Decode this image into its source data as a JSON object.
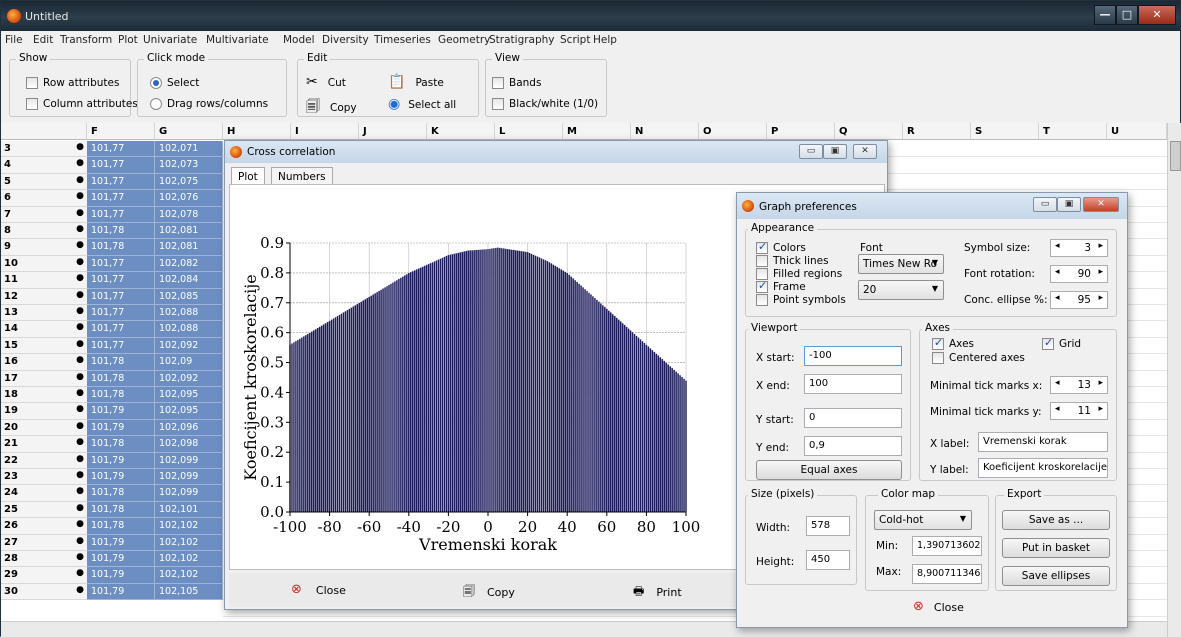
{
  "main_window": {
    "title": "Untitled",
    "controls": {
      "minimize": "—",
      "maximize": "□",
      "close": "✕"
    }
  },
  "menu": [
    "File",
    "Edit",
    "Transform",
    "Plot",
    "Univariate",
    "Multivariate",
    "Model",
    "Diversity",
    "Timeseries",
    "Geometry",
    "Stratigraphy",
    "Script",
    "Help"
  ],
  "toolbar": {
    "show": {
      "label": "Show",
      "row_attributes": "Row attributes",
      "column_attributes": "Column attributes"
    },
    "click_mode": {
      "label": "Click mode",
      "select": "Select",
      "drag": "Drag rows/columns"
    },
    "edit": {
      "label": "Edit",
      "cut": "Cut",
      "paste": "Paste",
      "copy": "Copy",
      "select_all": "Select all"
    },
    "view": {
      "label": "View",
      "bands": "Bands",
      "black_white": "Black/white (1/0)"
    }
  },
  "grid": {
    "columns": [
      "F",
      "G",
      "H",
      "I",
      "J",
      "K",
      "L",
      "M",
      "N",
      "O",
      "P",
      "Q",
      "R",
      "S",
      "T",
      "U"
    ],
    "rows": [
      {
        "id": "3",
        "f": "101,77",
        "g": "102,071"
      },
      {
        "id": "4",
        "f": "101,77",
        "g": "102,073"
      },
      {
        "id": "5",
        "f": "101,77",
        "g": "102,075"
      },
      {
        "id": "6",
        "f": "101,77",
        "g": "102,076"
      },
      {
        "id": "7",
        "f": "101,77",
        "g": "102,078"
      },
      {
        "id": "8",
        "f": "101,78",
        "g": "102,081"
      },
      {
        "id": "9",
        "f": "101,78",
        "g": "102,081"
      },
      {
        "id": "10",
        "f": "101,77",
        "g": "102,082"
      },
      {
        "id": "11",
        "f": "101,77",
        "g": "102,084"
      },
      {
        "id": "12",
        "f": "101,77",
        "g": "102,085"
      },
      {
        "id": "13",
        "f": "101,77",
        "g": "102,088"
      },
      {
        "id": "14",
        "f": "101,77",
        "g": "102,088"
      },
      {
        "id": "15",
        "f": "101,77",
        "g": "102,092"
      },
      {
        "id": "16",
        "f": "101,78",
        "g": "102,09"
      },
      {
        "id": "17",
        "f": "101,78",
        "g": "102,092"
      },
      {
        "id": "18",
        "f": "101,78",
        "g": "102,095"
      },
      {
        "id": "19",
        "f": "101,79",
        "g": "102,095"
      },
      {
        "id": "20",
        "f": "101,79",
        "g": "102,096"
      },
      {
        "id": "21",
        "f": "101,78",
        "g": "102,098"
      },
      {
        "id": "22",
        "f": "101,79",
        "g": "102,099"
      },
      {
        "id": "23",
        "f": "101,79",
        "g": "102,099"
      },
      {
        "id": "24",
        "f": "101,78",
        "g": "102,099"
      },
      {
        "id": "25",
        "f": "101,78",
        "g": "102,101"
      },
      {
        "id": "26",
        "f": "101,78",
        "g": "102,102"
      },
      {
        "id": "27",
        "f": "101,79",
        "g": "102,102"
      },
      {
        "id": "28",
        "f": "101,79",
        "g": "102,102"
      },
      {
        "id": "29",
        "f": "101,79",
        "g": "102,102"
      },
      {
        "id": "30",
        "f": "101,79",
        "g": "102,105"
      }
    ]
  },
  "cross_correlation": {
    "title": "Cross correlation",
    "tabs": [
      "Plot",
      "Numbers"
    ],
    "close": "Close",
    "copy": "Copy",
    "print": "Print"
  },
  "chart_data": {
    "type": "bar",
    "xlabel": "Vremenski korak",
    "ylabel": "Koeficijent kroskorelacije",
    "xlim": [
      -100,
      100
    ],
    "ylim": [
      0,
      0.9
    ],
    "xticks": [
      "-100",
      "-80",
      "-60",
      "-40",
      "-20",
      "0",
      "20",
      "40",
      "60",
      "80",
      "100"
    ],
    "yticks": [
      "0.0",
      "0.1",
      "0.2",
      "0.3",
      "0.4",
      "0.5",
      "0.6",
      "0.7",
      "0.8",
      "0.9"
    ],
    "x": [
      -100,
      -90,
      -80,
      -70,
      -60,
      -50,
      -40,
      -30,
      -20,
      -10,
      0,
      5,
      10,
      20,
      30,
      40,
      50,
      60,
      70,
      80,
      90,
      100
    ],
    "y": [
      0.56,
      0.6,
      0.64,
      0.68,
      0.72,
      0.76,
      0.8,
      0.83,
      0.86,
      0.875,
      0.88,
      0.885,
      0.88,
      0.87,
      0.84,
      0.8,
      0.74,
      0.68,
      0.62,
      0.56,
      0.5,
      0.44
    ],
    "grid": true,
    "bar_color": "#1c1c5c"
  },
  "graph_preferences": {
    "title": "Graph preferences",
    "appearance": {
      "label": "Appearance",
      "colors": "Colors",
      "thick_lines": "Thick lines",
      "filled_regions": "Filled regions",
      "frame": "Frame",
      "point_symbols": "Point symbols",
      "font_label": "Font",
      "font_value": "Times New Ro",
      "font_size": "20",
      "symbol_size_label": "Symbol size:",
      "symbol_size": "3",
      "font_rotation_label": "Font rotation:",
      "font_rotation": "90",
      "conc_ellipse_label": "Conc. ellipse %:",
      "conc_ellipse": "95"
    },
    "viewport": {
      "label": "Viewport",
      "x_start_label": "X start:",
      "x_start": "-100",
      "x_end_label": "X end:",
      "x_end": "100",
      "y_start_label": "Y start:",
      "y_start": "0",
      "y_end_label": "Y end:",
      "y_end": "0,9",
      "equal_axes": "Equal axes"
    },
    "axes": {
      "label": "Axes",
      "axes": "Axes",
      "grid": "Grid",
      "centered": "Centered axes",
      "min_ticks_x_label": "Minimal tick marks x:",
      "min_ticks_x": "13",
      "min_ticks_y_label": "Minimal tick marks y:",
      "min_ticks_y": "11",
      "x_label_label": "X label:",
      "x_label": "Vremenski korak",
      "y_label_label": "Y label:",
      "y_label": "Koeficijent kroskorelacije"
    },
    "size": {
      "label": "Size (pixels)",
      "width_label": "Width:",
      "width": "578",
      "height_label": "Height:",
      "height": "450"
    },
    "color_map": {
      "label": "Color map",
      "value": "Cold-hot",
      "min_label": "Min:",
      "min": "1,390713602",
      "max_label": "Max:",
      "max": "8,900711346"
    },
    "export": {
      "label": "Export",
      "save_as": "Save as ...",
      "put_in_basket": "Put in basket",
      "save_ellipses": "Save ellipses"
    },
    "close": "Close"
  }
}
